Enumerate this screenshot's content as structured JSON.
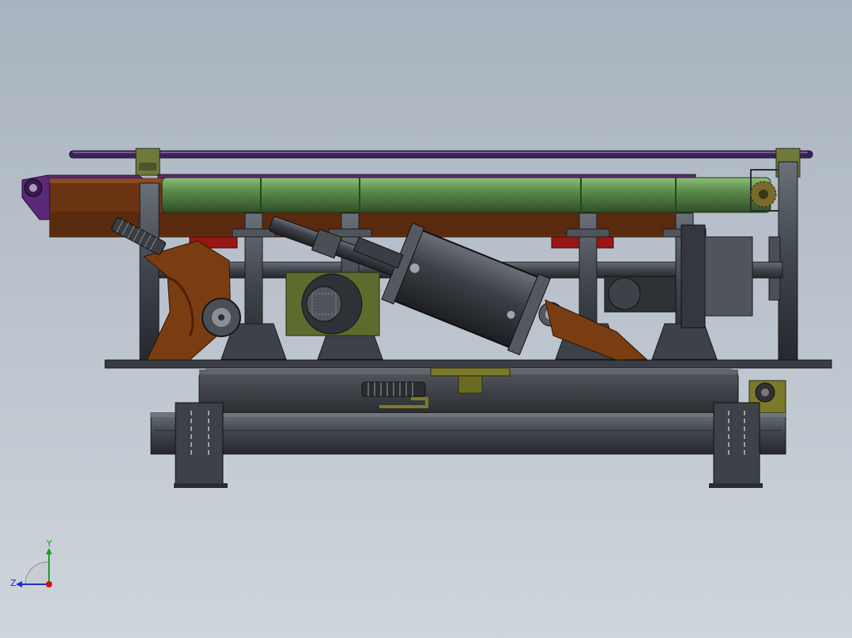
{
  "triad": {
    "y_label": "Y",
    "z_label": "Z",
    "x_color": "#d01010",
    "y_color": "#17a02a",
    "z_color": "#1a2fd0"
  },
  "model_colors": {
    "background_top": "#a9b3bf",
    "background_bottom": "#cfd5dc",
    "frame": "#3d4248",
    "green_tube": "#5a8c4a",
    "brown_plate": "#6b3412",
    "purple_rod": "#4a2a6a",
    "cylinder": "#3a3e44",
    "olive_bracket": "#7a7a2a",
    "red_accent": "#a01818"
  }
}
